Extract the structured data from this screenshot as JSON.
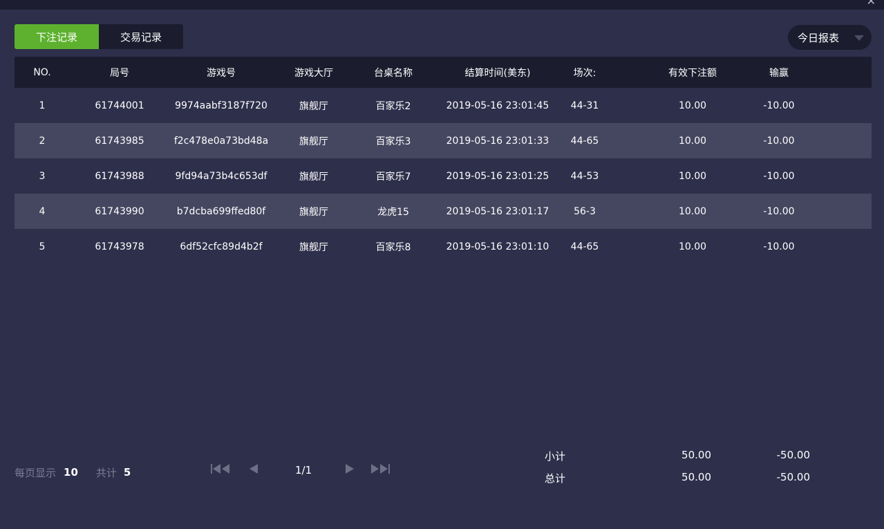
{
  "tabs": [
    {
      "label": "下注记录",
      "active": true
    },
    {
      "label": "交易记录",
      "active": false
    }
  ],
  "report_dropdown": {
    "label": "今日报表"
  },
  "table": {
    "headers": [
      "NO.",
      "局号",
      "游戏号",
      "游戏大厅",
      "台桌名称",
      "结算时间(美东)",
      "场次:",
      "有效下注额",
      "输赢"
    ],
    "rows": [
      [
        "1",
        "61744001",
        "9974aabf3187f720",
        "旗舰厅",
        "百家乐2",
        "2019-05-16 23:01:45",
        "44-31",
        "10.00",
        "-10.00"
      ],
      [
        "2",
        "61743985",
        "f2c478e0a73bd48a",
        "旗舰厅",
        "百家乐3",
        "2019-05-16 23:01:33",
        "44-65",
        "10.00",
        "-10.00"
      ],
      [
        "3",
        "61743988",
        "9fd94a73b4c653df",
        "旗舰厅",
        "百家乐7",
        "2019-05-16 23:01:25",
        "44-53",
        "10.00",
        "-10.00"
      ],
      [
        "4",
        "61743990",
        "b7dcba699ffed80f",
        "旗舰厅",
        "龙虎15",
        "2019-05-16 23:01:17",
        "56-3",
        "10.00",
        "-10.00"
      ],
      [
        "5",
        "61743978",
        "6df52cfc89d4b2f",
        "旗舰厅",
        "百家乐8",
        "2019-05-16 23:01:10",
        "44-65",
        "10.00",
        "-10.00"
      ]
    ]
  },
  "footer": {
    "per_page_label": "每页显示",
    "per_page_value": "10",
    "total_label": "共计",
    "total_value": "5",
    "page_indicator": "1/1"
  },
  "summary": {
    "subtotal_label": "小计",
    "subtotal_bet": "50.00",
    "subtotal_winloss": "-50.00",
    "total_label": "总计",
    "total_bet": "50.00",
    "total_winloss": "-50.00"
  },
  "colors": {
    "background": "#2e2f4b",
    "header_bg": "#1b1c2e",
    "alt_row": "#454660",
    "active_tab": "#5db12f"
  },
  "icons": [
    "close-icon",
    "caret-down-icon",
    "first-page-icon",
    "prev-page-icon",
    "next-page-icon",
    "last-page-icon"
  ]
}
